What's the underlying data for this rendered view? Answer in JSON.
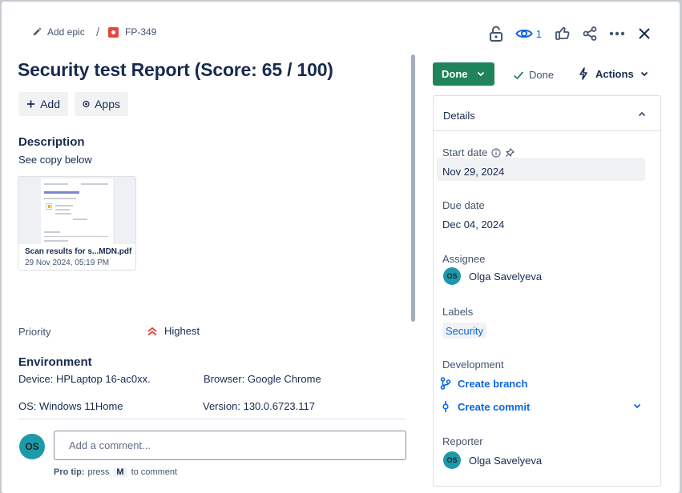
{
  "header": {
    "add_epic": "Add epic",
    "separator": "/",
    "issue_key": "FP-349",
    "watch_count": "1"
  },
  "issue": {
    "title": "Security test Report (Score: 65 / 100)",
    "add_label": "Add",
    "apps_label": "Apps",
    "description_heading": "Description",
    "description_text": "See copy below",
    "attachment": {
      "name": "Scan results for s...MDN.pdf",
      "date": "29 Nov 2024, 05:19 PM"
    },
    "priority_label": "Priority",
    "priority_value": "Highest",
    "environment_heading": "Environment",
    "environment": {
      "device": "Device: HPLaptop 16-ac0xx.",
      "browser": "Browser:  Google Chrome",
      "os": "OS: Windows 11Home",
      "version": "Version: 130.0.6723.117"
    }
  },
  "comment": {
    "avatar_initials": "OS",
    "placeholder": "Add a comment...",
    "protip_label": "Pro tip:",
    "protip_press": "press",
    "protip_key": "M",
    "protip_suffix": "to comment"
  },
  "sidebar": {
    "status_button": "Done",
    "resolution": "Done",
    "actions": "Actions",
    "details_title": "Details",
    "start_date_label": "Start date",
    "start_date_value": "Nov 29, 2024",
    "due_date_label": "Due date",
    "due_date_value": "Dec 04, 2024",
    "assignee_label": "Assignee",
    "assignee_initials": "OS",
    "assignee_name": "Olga Savelyeva",
    "labels_label": "Labels",
    "label_value": "Security",
    "development_label": "Development",
    "create_branch": "Create branch",
    "create_commit": "Create commit",
    "reporter_label": "Reporter",
    "reporter_initials": "OS",
    "reporter_name": "Olga Savelyeva"
  },
  "colors": {
    "status_green": "#1f845a",
    "link_blue": "#0c66e4",
    "avatar_teal": "#1d9aaa",
    "priority_orange": "#e2483d"
  }
}
